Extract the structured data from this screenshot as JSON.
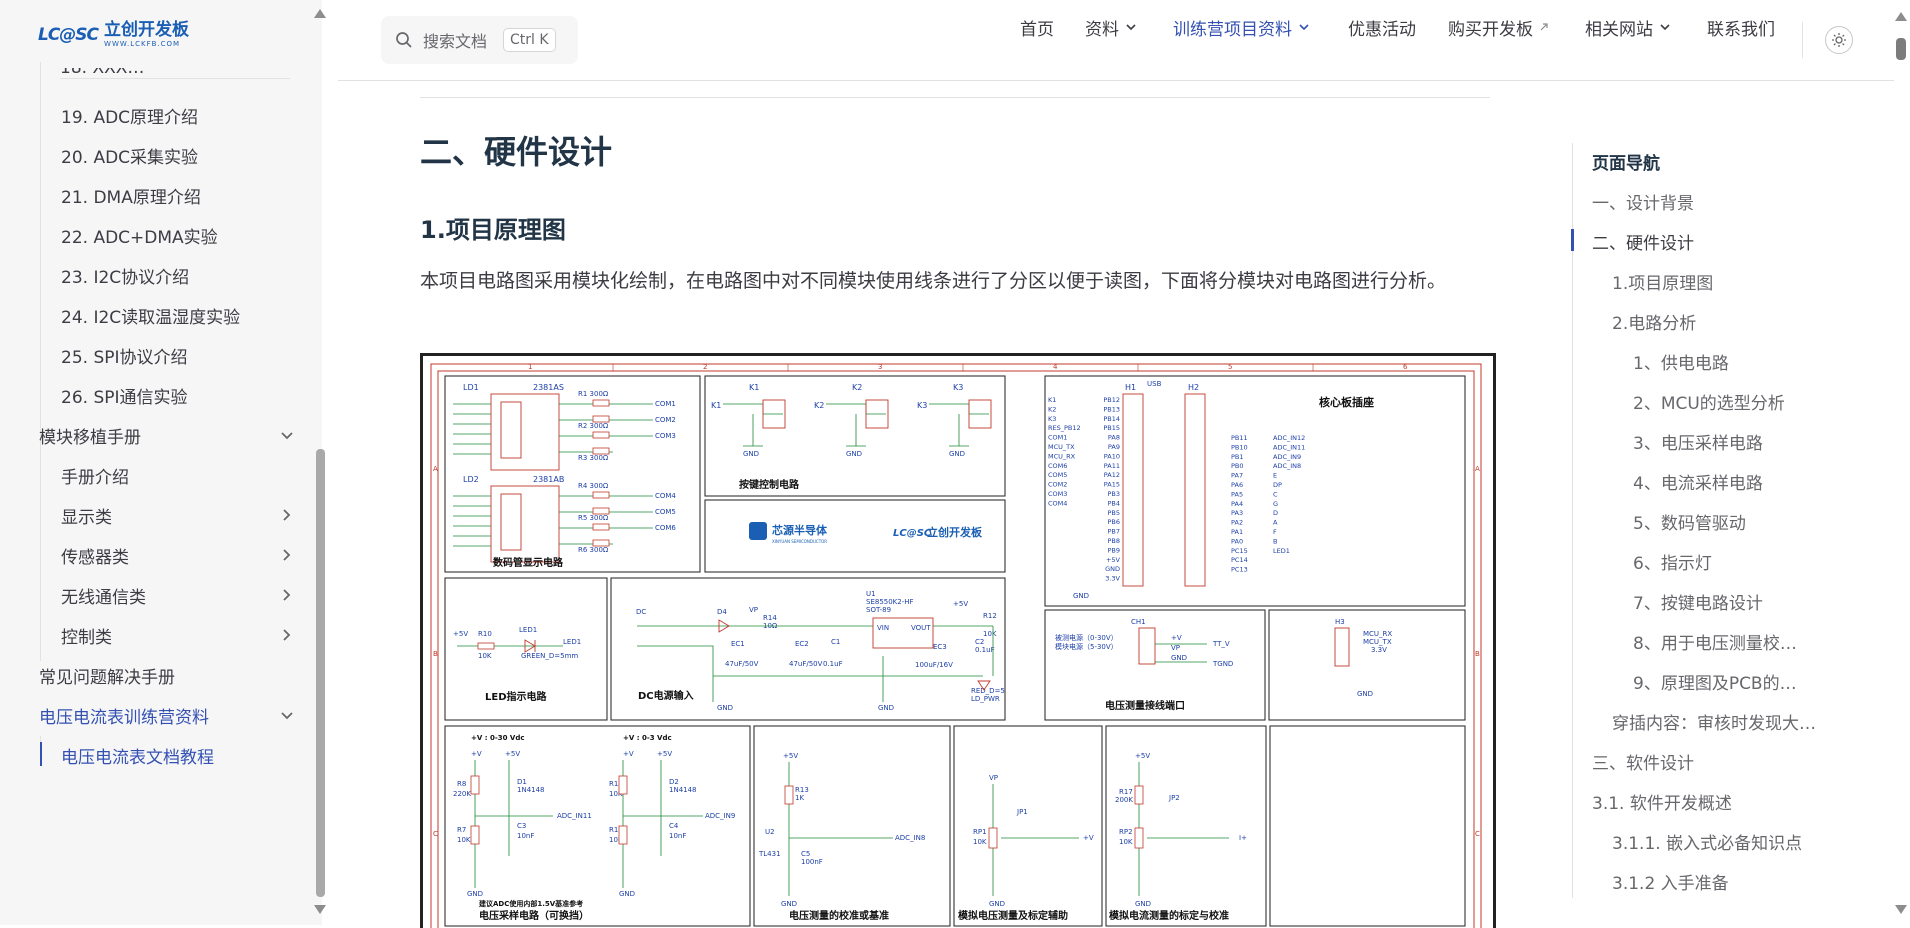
{
  "logo": {
    "mark": "LC@SC",
    "name": "立创开发板",
    "url_text": "WWW.LCKFB.COM"
  },
  "sidebar": {
    "cut_item": "18. XXX…",
    "items": [
      {
        "label": "19. ADC原理介绍"
      },
      {
        "label": "20. ADC采集实验"
      },
      {
        "label": "21. DMA原理介绍"
      },
      {
        "label": "22. ADC+DMA实验"
      },
      {
        "label": "23. I2C协议介绍"
      },
      {
        "label": "24. I2C读取温湿度实验"
      },
      {
        "label": "25. SPI协议介绍"
      },
      {
        "label": "26. SPI通信实验"
      }
    ],
    "module_section": "模块移植手册",
    "module_items": [
      {
        "label": "手册介绍"
      },
      {
        "label": "显示类"
      },
      {
        "label": "传感器类"
      },
      {
        "label": "无线通信类"
      },
      {
        "label": "控制类"
      }
    ],
    "faq": "常见问题解决手册",
    "camp_section": "电压电流表训练营资料",
    "camp_active": "电压电流表文档教程"
  },
  "search": {
    "placeholder": "搜索文档",
    "shortcut": "Ctrl K"
  },
  "nav": {
    "home": "首页",
    "materials": "资料",
    "camp": "训练营项目资料",
    "promo": "优惠活动",
    "buy": "购买开发板",
    "links": "相关网站",
    "contact": "联系我们"
  },
  "content": {
    "h2": "二、硬件设计",
    "h3": "1.项目原理图",
    "paragraph": "本项目电路图采用模块化绘制，在电路图中对不同模块使用线条进行了分区以便于读图，下面将分模块对电路图进行分析。"
  },
  "schematic": {
    "col_labels": [
      "1",
      "2",
      "3",
      "4",
      "5",
      "6"
    ],
    "row_labels": [
      "A",
      "B",
      "C"
    ],
    "blocks": {
      "seg": "数码管显示电路",
      "keys": "按键控制电路",
      "core": "核心板插座",
      "usb": "USB",
      "led": "LED指示电路",
      "dc": "DC电源输入",
      "vport": "电压测量接线端口",
      "vsample": "电压采样电路（可换挡）",
      "vsample_note": "建议ADC使用内部1.5V基准参考",
      "calib": "电压测量的校准或基准",
      "sim1": "模拟电压测量及标定辅助",
      "sim2": "模拟电流测量的标定与校准"
    },
    "brand1": "芯源半导体",
    "brand1_sub": "XINYUAN SEMICONDUCTOR",
    "brand2": "立创开发板",
    "range1": "+V : 0-30 Vdc",
    "range2": "+V : 0-3 Vdc",
    "gnd": "GND",
    "parts": {
      "ld1": "LD1",
      "ld2": "LD2",
      "seg1": "2381AS",
      "seg2": "2381AB",
      "r_seg": [
        "R1 300Ω",
        "R2 300Ω",
        "R3 300Ω",
        "R4 300Ω",
        "R5 300Ω",
        "R6 300Ω"
      ],
      "com": [
        "COM1",
        "COM2",
        "COM3",
        "COM4",
        "COM5",
        "COM6"
      ],
      "keys": [
        "K1",
        "K2",
        "K3"
      ],
      "led1": "LED1",
      "r10": "R10",
      "r10v": "10K",
      "green": "GREEN_D=5mm",
      "dc": "DC",
      "d4": "D4",
      "u1": "U1",
      "u1p": "SE8550K2-HF",
      "u1pkg": "SOT-89",
      "ec1": "EC1",
      "ec1v": "47uF/50V",
      "ec2": "EC2",
      "ec2v": "47uF/50V",
      "c1": "C1",
      "c1v": "0.1uF",
      "ec3": "EC3",
      "ec3v": "100uF/16V",
      "c2": "C2",
      "c2v": "0.1uF",
      "r12": "R12",
      "r12v": "10K",
      "red": "RED_D=5",
      "ldpwr": "LD_PWR",
      "r14": "R14",
      "r14v": "10Ω",
      "ch1": "CH1",
      "vr1": "被测电源（0-30V）",
      "vr2": "模块电源（5-30V）",
      "h3": "H3",
      "mcu_rx": "MCU_RX",
      "mcu_tx": "MCU_TX",
      "v33": "3.3V",
      "ttv": "TT_V",
      "ttgnd": "TGND",
      "r8": "R8",
      "r8v": "220K",
      "r7": "R7",
      "r7v": "10K",
      "d1": "D1",
      "d1p": "1N4148",
      "c3": "C3",
      "c3v": "10nF",
      "r15": "R15",
      "r15v": "10K",
      "r16": "R16",
      "r16v": "10K",
      "d2": "D2",
      "d2p": "1N4148",
      "c4": "C4",
      "c4v": "10nF",
      "adc11": "ADC_IN11",
      "adc9": "ADC_IN9",
      "adc8": "ADC_IN8",
      "r13": "R13",
      "r13v": "1K",
      "u2": "U2",
      "tl431": "TL431",
      "c5": "C5",
      "c5v": "100nF",
      "rp1": "RP1",
      "rp1v": "10K",
      "jp1": "JP1",
      "plusv": "+V",
      "r17": "R17",
      "r17v": "200K",
      "rp2": "RP2",
      "rp2v": "10K",
      "jp2": "JP2",
      "iplus": "I+",
      "h1": "H1",
      "h2": "H2",
      "p5v": "+5V",
      "vp": "VP"
    },
    "core_left_pins": [
      "PB12",
      "PB13",
      "PB14",
      "PB15",
      "PA8",
      "PA9",
      "PA10",
      "PA11",
      "PA12",
      "PA15",
      "PB3",
      "PB4",
      "PB5",
      "PB6",
      "PB7",
      "PB8",
      "PB9",
      "+5V",
      "GND",
      "3.3V"
    ],
    "core_left_nets": [
      "K1",
      "K2",
      "K3",
      "RES_PB12",
      "COM1",
      "MCU_TX",
      "MCU_RX",
      "COM6",
      "COM5",
      "COM2",
      "COM3",
      "COM4"
    ],
    "core_right_pins": [
      "PB11",
      "PB10",
      "PB1",
      "PB0",
      "PA7",
      "PA6",
      "PA5",
      "PA4",
      "PA3",
      "PA2",
      "PA1",
      "PA0",
      "PC15",
      "PC14",
      "PC13"
    ],
    "core_right_nets": [
      "ADC_IN12",
      "ADC_IN11",
      "ADC_IN9",
      "ADC_IN8",
      "E",
      "DP",
      "C",
      "G",
      "D",
      "A",
      "F",
      "B",
      "LED1"
    ]
  },
  "toc": {
    "title": "页面导航",
    "items": [
      {
        "label": "一、设计背景",
        "level": 1
      },
      {
        "label": "二、硬件设计",
        "level": 1
      },
      {
        "label": "1.项目原理图",
        "level": 2
      },
      {
        "label": "2.电路分析",
        "level": 2
      },
      {
        "label": "1、供电电路",
        "level": 3
      },
      {
        "label": "2、MCU的选型分析",
        "level": 3
      },
      {
        "label": "3、电压采样电路",
        "level": 3
      },
      {
        "label": "4、电流采样电路",
        "level": 3
      },
      {
        "label": "5、数码管驱动",
        "level": 3
      },
      {
        "label": "6、指示灯",
        "level": 3
      },
      {
        "label": "7、按键电路设计",
        "level": 3
      },
      {
        "label": "8、用于电压测量校…",
        "level": 3
      },
      {
        "label": "9、原理图及PCB的…",
        "level": 3
      },
      {
        "label": "穿插内容：审核时发现大…",
        "level": 2
      },
      {
        "label": "三、软件设计",
        "level": 1
      },
      {
        "label": "3.1. 软件开发概述",
        "level": 1
      },
      {
        "label": "3.1.1. 嵌入式必备知识点",
        "level": 2
      },
      {
        "label": "3.1.2 入手准备",
        "level": 2
      }
    ]
  }
}
